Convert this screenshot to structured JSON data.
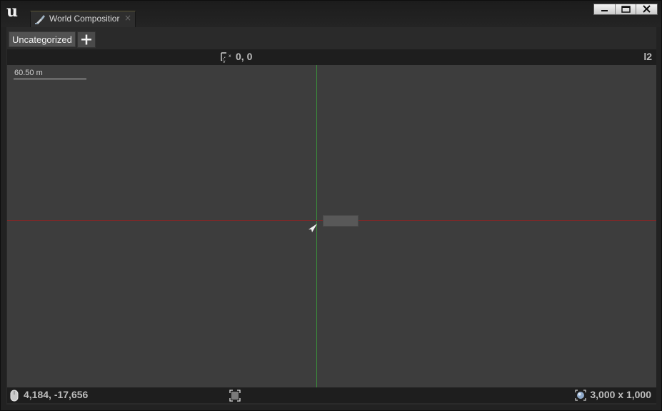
{
  "window": {
    "logo_icon": "unreal-engine-logo",
    "tab": {
      "icon": "world-composition-brush-icon",
      "title": "World Compositior",
      "close_glyph": "×"
    },
    "controls": [
      "minimize",
      "restore",
      "close"
    ]
  },
  "layers": {
    "items": [
      {
        "label": "Uncategorized"
      }
    ],
    "add_label": "+"
  },
  "viewport": {
    "origin_icon": "origin-axes-icon",
    "origin_coords": "0, 0",
    "current_level": "l2",
    "scale_label": "60.50 m",
    "axis_colors": {
      "x": "#7a2a2a",
      "y": "#3a8f3a"
    },
    "background": "#3d3d3d"
  },
  "status": {
    "mouse_icon": "mouse-icon",
    "mouse_position": "4,184, -17,656",
    "selection_icon": "selection-bounds-icon",
    "world_icon": "world-globe-icon",
    "world_size": "3,000 x 1,000"
  }
}
